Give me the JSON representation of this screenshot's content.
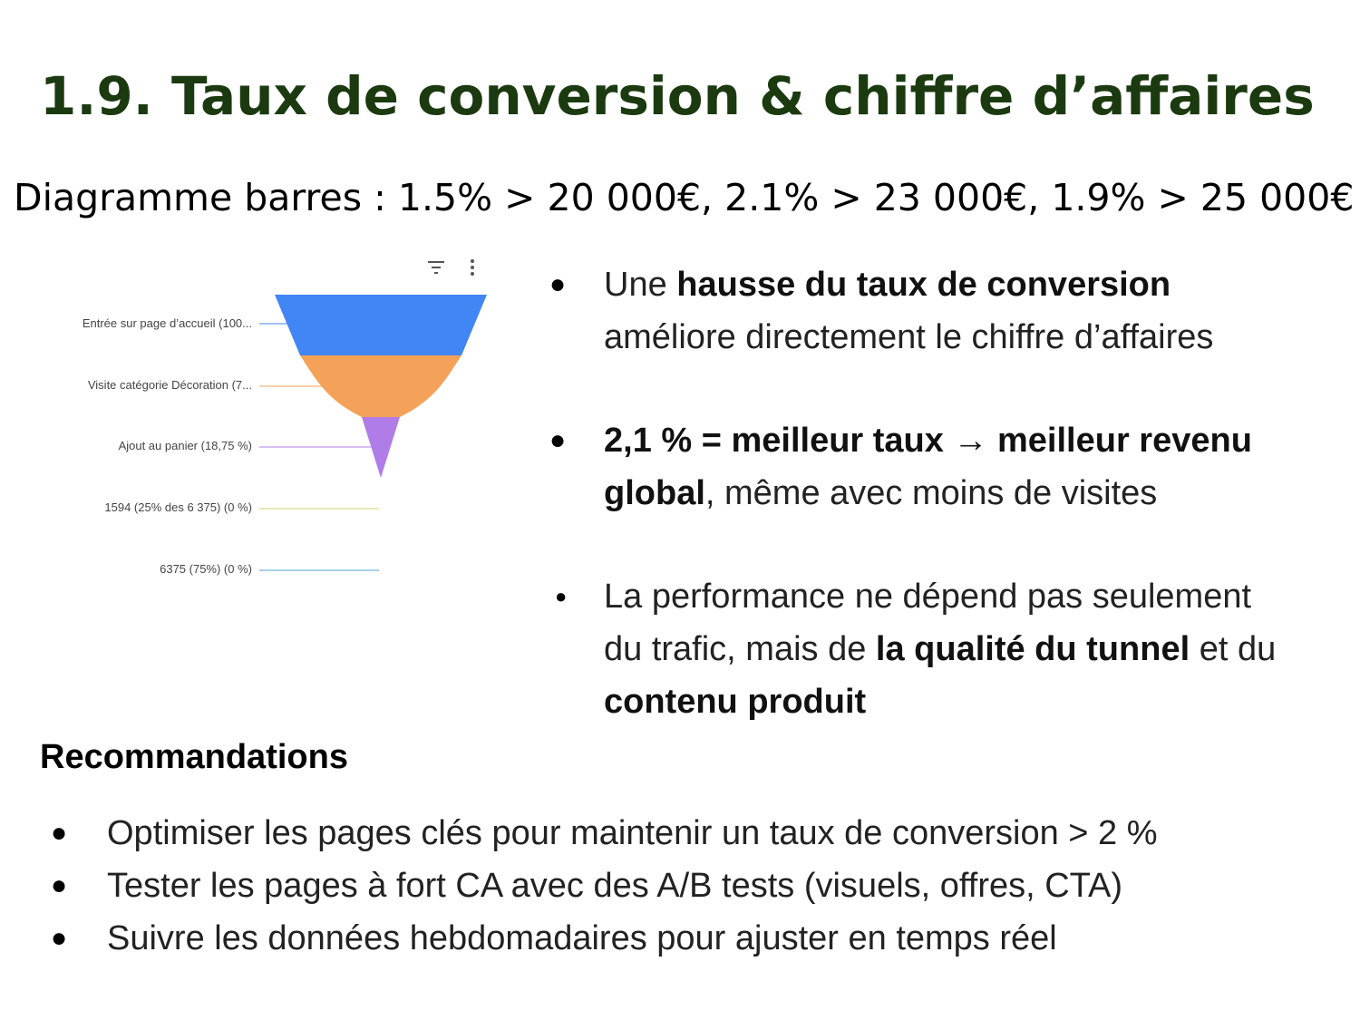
{
  "slide": {
    "title": "1.9. Taux de conversion & chiffre d’affaires",
    "subtitle": "Diagramme barres : 1.5% > 20 000€, 2.1% > 23 000€, 1.9% > 25 000€"
  },
  "funnel": {
    "toolbar": {
      "filter_icon": "filter-icon",
      "more_icon": "more-vert-icon"
    },
    "stages": [
      {
        "label": "Entrée sur page d’accueil (100...",
        "value_pct": 100,
        "color": "#4285f4"
      },
      {
        "label": "Visite catégorie Décoration (7...",
        "value_pct": 75,
        "color": "#f4a259"
      },
      {
        "label": "Ajout au panier (18,75 %)",
        "value_pct": 18.75,
        "color": "#b07ce8"
      },
      {
        "label": "1594 (25% des 6 375) (0 %)",
        "value_pct": 0,
        "color": "#c9d36b"
      },
      {
        "label": "6375 (75%) (0 %)",
        "value_pct": 0,
        "color": "#4aa3df"
      }
    ]
  },
  "bullets": [
    {
      "parts": [
        {
          "text": "Une ",
          "bold": false
        },
        {
          "text": "hausse du taux de conversion",
          "bold": true
        }
      ],
      "line2": "améliore directement le chiffre d’affaires"
    },
    {
      "line1": "2,1 % = meilleur taux → meilleur revenu",
      "line2_bold": "global",
      "line2_rest": ", même avec moins de visites"
    },
    {
      "line1": "La performance ne dépend pas seulement",
      "line2_start": "du trafic, mais de ",
      "line2_bold": "la qualité du tunnel",
      "line2_end": " et du",
      "line3_bold": "contenu produit"
    }
  ],
  "recommendations": {
    "heading": "Recommandations",
    "items": [
      "Optimiser les pages clés pour maintenir un taux de conversion > 2 %",
      "Tester les pages à fort CA avec des A/B tests (visuels, offres, CTA)",
      "Suivre les données hebdomadaires pour ajuster en temps réel"
    ]
  },
  "bullet_symbol": "●"
}
